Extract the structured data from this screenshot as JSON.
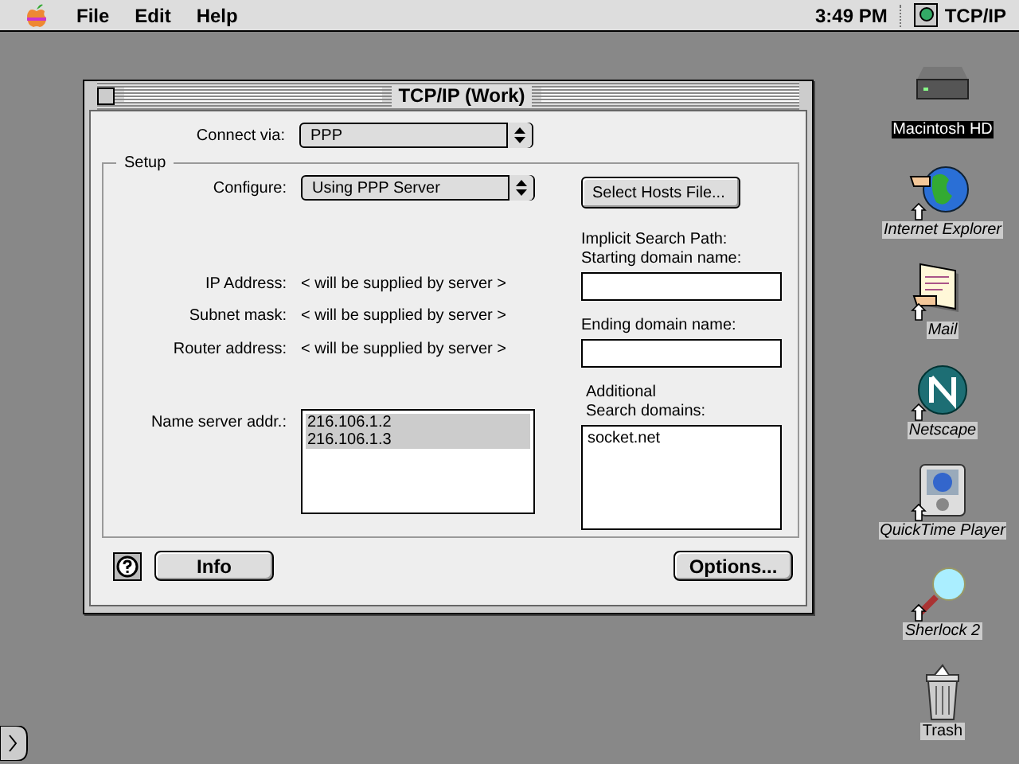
{
  "menu_bar": {
    "menus": [
      "File",
      "Edit",
      "Help"
    ],
    "clock": "3:49 PM",
    "app": "TCP/IP"
  },
  "window": {
    "title": "TCP/IP (Work)"
  },
  "connect_via": {
    "label": "Connect via:",
    "value": "PPP"
  },
  "setup": {
    "title": "Setup",
    "configure": {
      "label": "Configure:",
      "value": "Using PPP Server"
    },
    "fields": [
      {
        "label": "IP Address:",
        "value": "< will be supplied by server >"
      },
      {
        "label": "Subnet mask:",
        "value": "< will be supplied by server >"
      },
      {
        "label": "Router address:",
        "value": "< will be supplied by server >"
      }
    ],
    "name_servers": {
      "label": "Name server addr.:",
      "entries": [
        {
          "text": "216.106.1.2",
          "selected": true
        },
        {
          "text": "216.106.1.3",
          "selected": true
        }
      ]
    },
    "hosts_button": "Select Hosts File...",
    "search_path_heading": "Implicit Search Path:",
    "starting_domain_label": "Starting domain name:",
    "ending_domain_label": "Ending domain name:",
    "additional_label": [
      "Additional",
      "Search domains:"
    ],
    "search_domains": [
      "socket.net"
    ]
  },
  "buttons": [
    {
      "kind": "help"
    },
    {
      "kind": "push",
      "label": "Info"
    },
    {
      "kind": "push",
      "label": "Options..."
    }
  ],
  "desktop_icons": [
    {
      "kind": "disk",
      "label": "Macintosh HD",
      "selected": true,
      "alias": false
    },
    {
      "kind": "globe",
      "label": "Internet Explorer",
      "selected": false,
      "alias": true
    },
    {
      "kind": "mail",
      "label": "Mail",
      "selected": false,
      "alias": true
    },
    {
      "kind": "netscape",
      "label": "Netscape",
      "selected": false,
      "alias": true
    },
    {
      "kind": "player",
      "label": "QuickTime Player",
      "selected": false,
      "alias": true
    },
    {
      "kind": "magnifier",
      "label": "Sherlock 2",
      "selected": false,
      "alias": true
    },
    {
      "kind": "trash",
      "label": "Trash",
      "selected": false,
      "alias": false
    }
  ]
}
